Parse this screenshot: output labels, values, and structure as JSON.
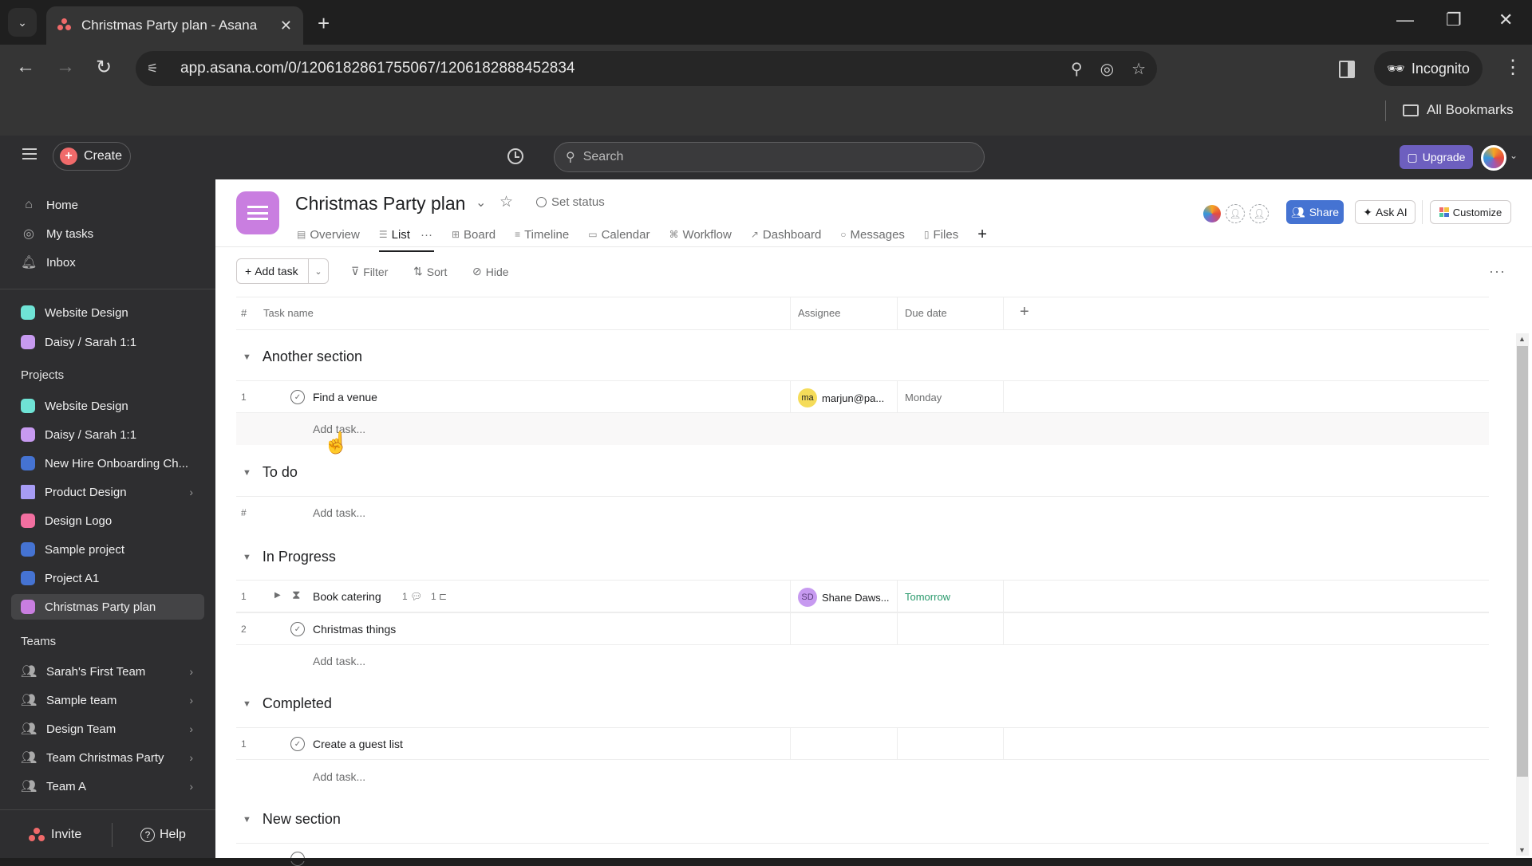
{
  "browser": {
    "tab_title": "Christmas Party plan - Asana",
    "url": "app.asana.com/0/1206182861755067/1206182888452834",
    "incognito_label": "Incognito",
    "all_bookmarks": "All Bookmarks"
  },
  "topbar": {
    "create_label": "Create",
    "search_placeholder": "Search",
    "upgrade_label": "Upgrade"
  },
  "sidebar": {
    "nav": [
      {
        "label": "Home",
        "icon": "home-icon"
      },
      {
        "label": "My tasks",
        "icon": "check-circle-icon"
      },
      {
        "label": "Inbox",
        "icon": "bell-icon"
      }
    ],
    "favorites": [
      {
        "label": "Website Design",
        "color": "#6fe3d5"
      },
      {
        "label": "Daisy / Sarah 1:1",
        "color": "#c79af0"
      }
    ],
    "projects_heading": "Projects",
    "projects": [
      {
        "label": "Website Design",
        "color": "#6fe3d5"
      },
      {
        "label": "Daisy / Sarah 1:1",
        "color": "#c79af0"
      },
      {
        "label": "New Hire Onboarding Ch...",
        "color": "#4573d2"
      },
      {
        "label": "Product Design",
        "color": "#a79cf5",
        "folder": true
      },
      {
        "label": "Design Logo",
        "color": "#f26fa0"
      },
      {
        "label": "Sample project",
        "color": "#4573d2"
      },
      {
        "label": "Project A1",
        "color": "#4573d2"
      },
      {
        "label": "Christmas Party plan",
        "color": "#c97ee0",
        "active": true
      }
    ],
    "teams_heading": "Teams",
    "teams": [
      {
        "label": "Sarah's First Team"
      },
      {
        "label": "Sample team"
      },
      {
        "label": "Design Team"
      },
      {
        "label": "Team Christmas Party"
      },
      {
        "label": "Team A"
      }
    ],
    "invite_label": "Invite",
    "help_label": "Help"
  },
  "project": {
    "title": "Christmas Party plan",
    "set_status": "Set status",
    "tabs": [
      {
        "label": "Overview",
        "icon": "▤"
      },
      {
        "label": "List",
        "icon": "☰",
        "active": true
      },
      {
        "label": "Board",
        "icon": "⊞"
      },
      {
        "label": "Timeline",
        "icon": "≡"
      },
      {
        "label": "Calendar",
        "icon": "▭"
      },
      {
        "label": "Workflow",
        "icon": "⌘"
      },
      {
        "label": "Dashboard",
        "icon": "↗"
      },
      {
        "label": "Messages",
        "icon": "○"
      },
      {
        "label": "Files",
        "icon": "▯"
      }
    ],
    "share_label": "Share",
    "ask_ai_label": "Ask AI",
    "customize_label": "Customize",
    "brand_color": "#4573d2"
  },
  "list_toolbar": {
    "add_task": "Add task",
    "filter": "Filter",
    "sort": "Sort",
    "hide": "Hide"
  },
  "table": {
    "columns": [
      "#",
      "Task name",
      "Assignee",
      "Due date"
    ],
    "add_task_placeholder": "Add task...",
    "sections": [
      {
        "name": "Another section",
        "tasks": [
          {
            "num": "1",
            "name": "Find a venue",
            "assignee_initials": "ma",
            "assignee": "marjun@pa...",
            "assignee_color": "#f5dc5a",
            "due": "Monday",
            "due_color": "#6d6e6f"
          }
        ]
      },
      {
        "name": "To do",
        "tasks": [],
        "empty_num": "#"
      },
      {
        "name": "In Progress",
        "tasks": [
          {
            "num": "1",
            "name": "Book catering",
            "comments": "1",
            "subtasks": "1",
            "assignee_initials": "SD",
            "assignee": "Shane Daws...",
            "assignee_color": "#c79af0",
            "due": "Tomorrow",
            "due_color": "#2b9a6d"
          },
          {
            "num": "2",
            "name": "Christmas things"
          }
        ]
      },
      {
        "name": "Completed",
        "tasks": [
          {
            "num": "1",
            "name": "Create a guest list"
          }
        ]
      },
      {
        "name": "New section",
        "tasks": []
      }
    ]
  }
}
